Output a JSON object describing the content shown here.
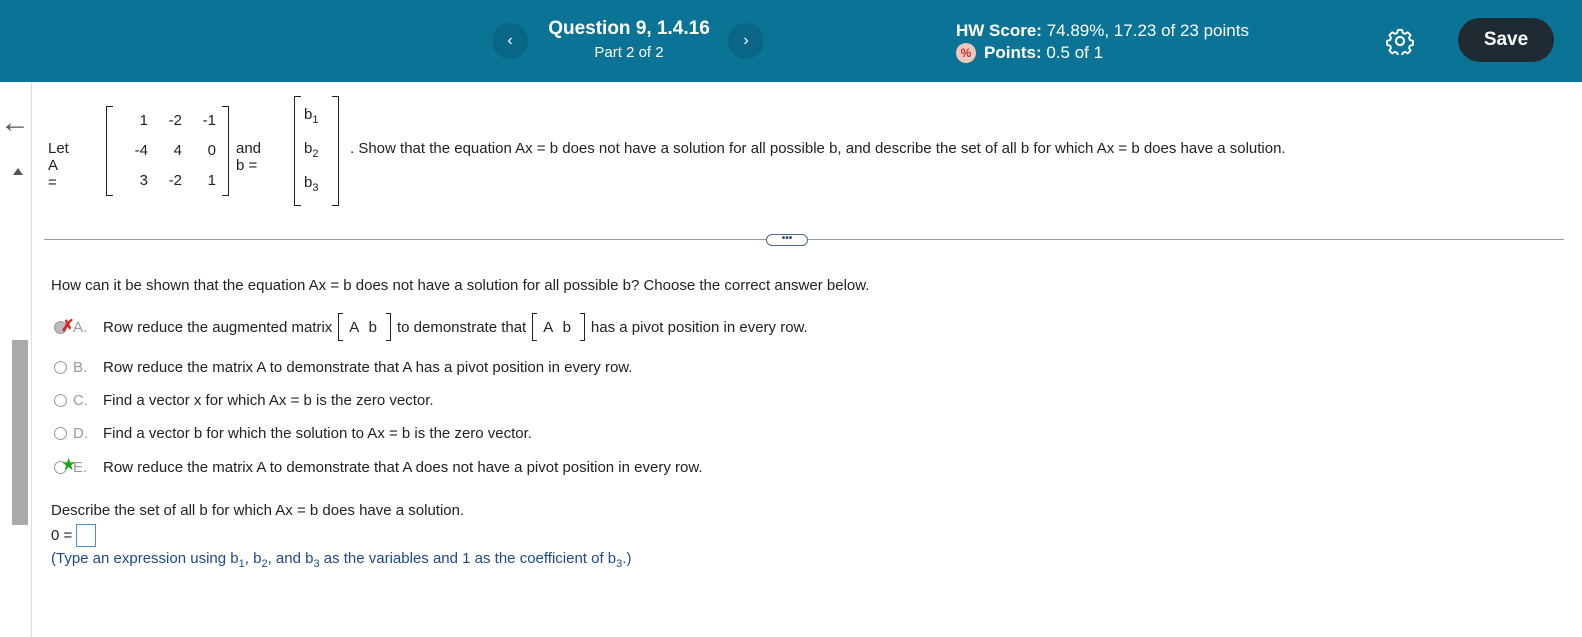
{
  "header": {
    "question_title": "Question 9, 1.4.16",
    "part": "Part 2 of 2",
    "hw_score_label": "HW Score:",
    "hw_score_value": "74.89%, 17.23 of 23 points",
    "points_label": "Points:",
    "points_value": "0.5 of 1",
    "prev_icon": "‹",
    "next_icon": "›",
    "save_label": "Save",
    "colors": {
      "bar": "#0b7496",
      "save": "#1f2a33"
    }
  },
  "problem": {
    "let": "Let A =",
    "matrix_a": [
      [
        "1",
        "-2",
        "-1"
      ],
      [
        "-4",
        "4",
        "0"
      ],
      [
        "3",
        "-2",
        "1"
      ]
    ],
    "and_b": "and b =",
    "b_entries": [
      {
        "base": "b",
        "sub": "1"
      },
      {
        "base": "b",
        "sub": "2"
      },
      {
        "base": "b",
        "sub": "3"
      }
    ],
    "statement": ". Show that the equation Ax = b does not have a solution for all possible b, and describe the set of all b for which Ax = b does have a solution."
  },
  "part1": {
    "question": "How can it be shown that the equation Ax = b does not have a solution for all possible b? Choose the correct answer below.",
    "options": [
      {
        "letter": "A.",
        "text_before": "Row reduce the augmented matrix",
        "matrix": "A b",
        "text_mid": "to demonstrate that",
        "text_after": "has a pivot position in every row.",
        "mark": "✗",
        "state": "selected-incorrect"
      },
      {
        "letter": "B.",
        "text": "Row reduce the matrix A to demonstrate that A has a pivot position in every row."
      },
      {
        "letter": "C.",
        "text": "Find a vector x for which Ax = b is the zero vector."
      },
      {
        "letter": "D.",
        "text": "Find a vector b for which the solution to Ax = b is the zero vector."
      },
      {
        "letter": "E.",
        "text": "Row reduce the matrix A to demonstrate that A does not have a pivot position in every row.",
        "mark": "★",
        "state": "correct"
      }
    ]
  },
  "part2": {
    "describe": "Describe the set of all b for which Ax = b does have a solution.",
    "zero_eq": "0 =",
    "answer_value": "",
    "hint_before": "(Type an expression using b",
    "hint_s1": "1",
    "hint_sep1": ", b",
    "hint_s2": "2",
    "hint_sep2": ", and b",
    "hint_s3": "3",
    "hint_mid": " as the variables and 1 as the coefficient of b",
    "hint_end": ".)"
  }
}
